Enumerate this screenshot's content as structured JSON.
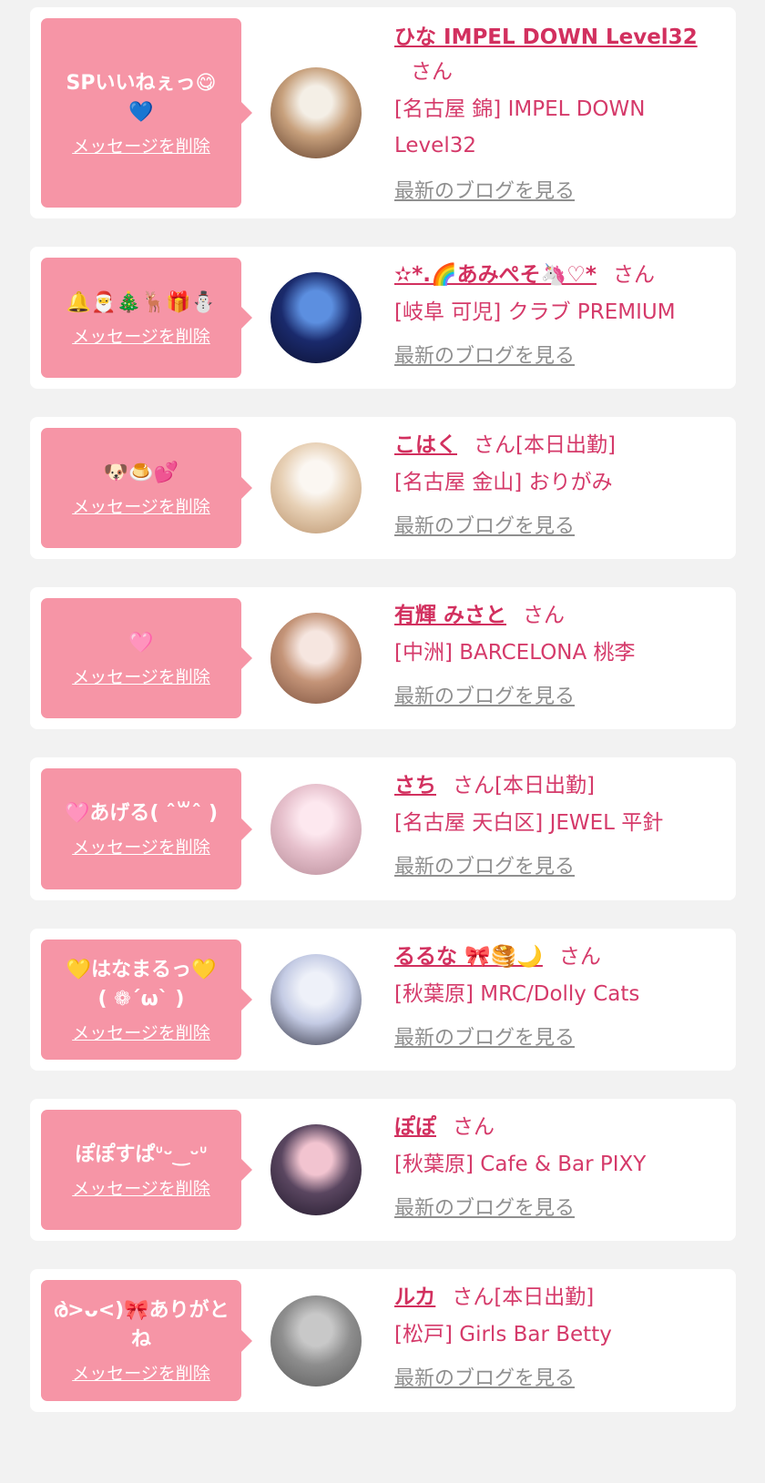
{
  "entries": [
    {
      "message": "SPいいねぇっ😋\n💙",
      "delete_label": "メッセージを削除",
      "name": "ひな IMPEL DOWN Level32",
      "suffix": "さん",
      "shop": "[名古屋 錦] IMPEL DOWN Level32",
      "blog_label": "最新のブログを見る",
      "avatar_colors": [
        "#f4efe6",
        "#c7a07c",
        "#5c3a28"
      ]
    },
    {
      "message": "🔔🎅🎄🦌🎁⛄",
      "delete_label": "メッセージを削除",
      "name": "✫*.🌈あみぺそ🦄♡*",
      "suffix": "さん",
      "shop": "[岐阜 可児] クラブ PREMIUM",
      "blog_label": "最新のブログを見る",
      "avatar_colors": [
        "#5c8fe0",
        "#1a2a6c",
        "#0b0f2e"
      ]
    },
    {
      "message": "🐶🍮💕",
      "delete_label": "メッセージを削除",
      "name": "こはく",
      "suffix": "さん[本日出勤]",
      "shop": "[名古屋 金山] おりがみ",
      "blog_label": "最新のブログを見る",
      "avatar_colors": [
        "#fbf7f2",
        "#e7d0b5",
        "#b9916a"
      ]
    },
    {
      "message": "🩷",
      "delete_label": "メッセージを削除",
      "name": "有輝 みさと",
      "suffix": "さん",
      "shop": "[中洲] BARCELONA 桃李",
      "blog_label": "最新のブログを見る",
      "avatar_colors": [
        "#f6e6e0",
        "#c49478",
        "#7a4f3c"
      ]
    },
    {
      "message": "🩷あげる( ˆ꒳ˆ )",
      "delete_label": "メッセージを削除",
      "name": "さち",
      "suffix": "さん[本日出勤]",
      "shop": "[名古屋 天白区] JEWEL 平針",
      "blog_label": "最新のブログを見る",
      "avatar_colors": [
        "#fde8ef",
        "#e6c0cc",
        "#b58a96"
      ]
    },
    {
      "message": "💛はなまるっ💛\n( ❁´ω` )",
      "delete_label": "メッセージを削除",
      "name": "るるな 🎀🥞🌙",
      "suffix": "さん",
      "shop": "[秋葉原] MRC/Dolly Cats",
      "blog_label": "最新のブログを見る",
      "avatar_colors": [
        "#eef1f9",
        "#c4cbe4",
        "#2b2b3a"
      ]
    },
    {
      "message": "ぽぽすぱᐡᵕ‿ᵕᐡ",
      "delete_label": "メッセージを削除",
      "name": "ぽぽ",
      "suffix": "さん",
      "shop": "[秋葉原] Cafe & Bar PIXY",
      "blog_label": "最新のブログを見る",
      "avatar_colors": [
        "#f2c4d0",
        "#5a4660",
        "#20182a"
      ]
    },
    {
      "message": "ര̀>ᴗ<)🎀ありがとね",
      "delete_label": "メッセージを削除",
      "name": "ルカ",
      "suffix": "さん[本日出勤]",
      "shop": "[松戸] Girls Bar Betty",
      "blog_label": "最新のブログを見る",
      "avatar_colors": [
        "#c8c8c8",
        "#8e8e8e",
        "#5a5a5a"
      ]
    }
  ]
}
